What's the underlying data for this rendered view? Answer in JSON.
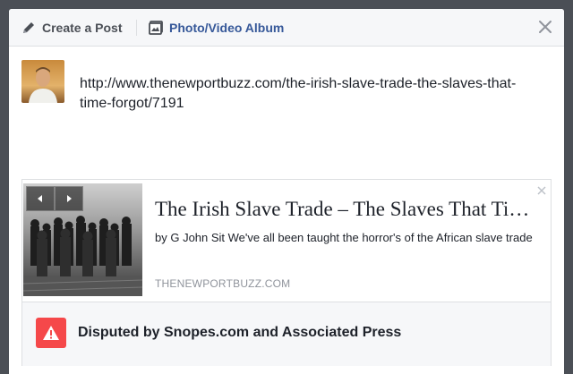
{
  "header": {
    "tabs": [
      {
        "label": "Create a Post",
        "icon": "pencil-icon",
        "color": "#4b4f56"
      },
      {
        "label": "Photo/Video Album",
        "icon": "photo-album-icon",
        "color": "#365899"
      }
    ],
    "close_icon": "close-icon"
  },
  "post": {
    "text": "http://www.thenewportbuzz.com/the-irish-slave-trade-the-slaves-that-time-forgot/7191",
    "avatar": "profile-photo"
  },
  "link_preview": {
    "title": "The Irish Slave Trade – The Slaves That Time Forgot",
    "description": "by G John Sit We've all been taught the horror's of the African slave trade",
    "domain": "THENEWPORTBUZZ.COM",
    "image": "historic-photo-of-children",
    "nav_icons": [
      "chevron-left-icon",
      "chevron-right-icon"
    ]
  },
  "dispute": {
    "text": "Disputed by Snopes.com and Associated Press",
    "icon": "warning-icon",
    "color": "#f5484a"
  }
}
